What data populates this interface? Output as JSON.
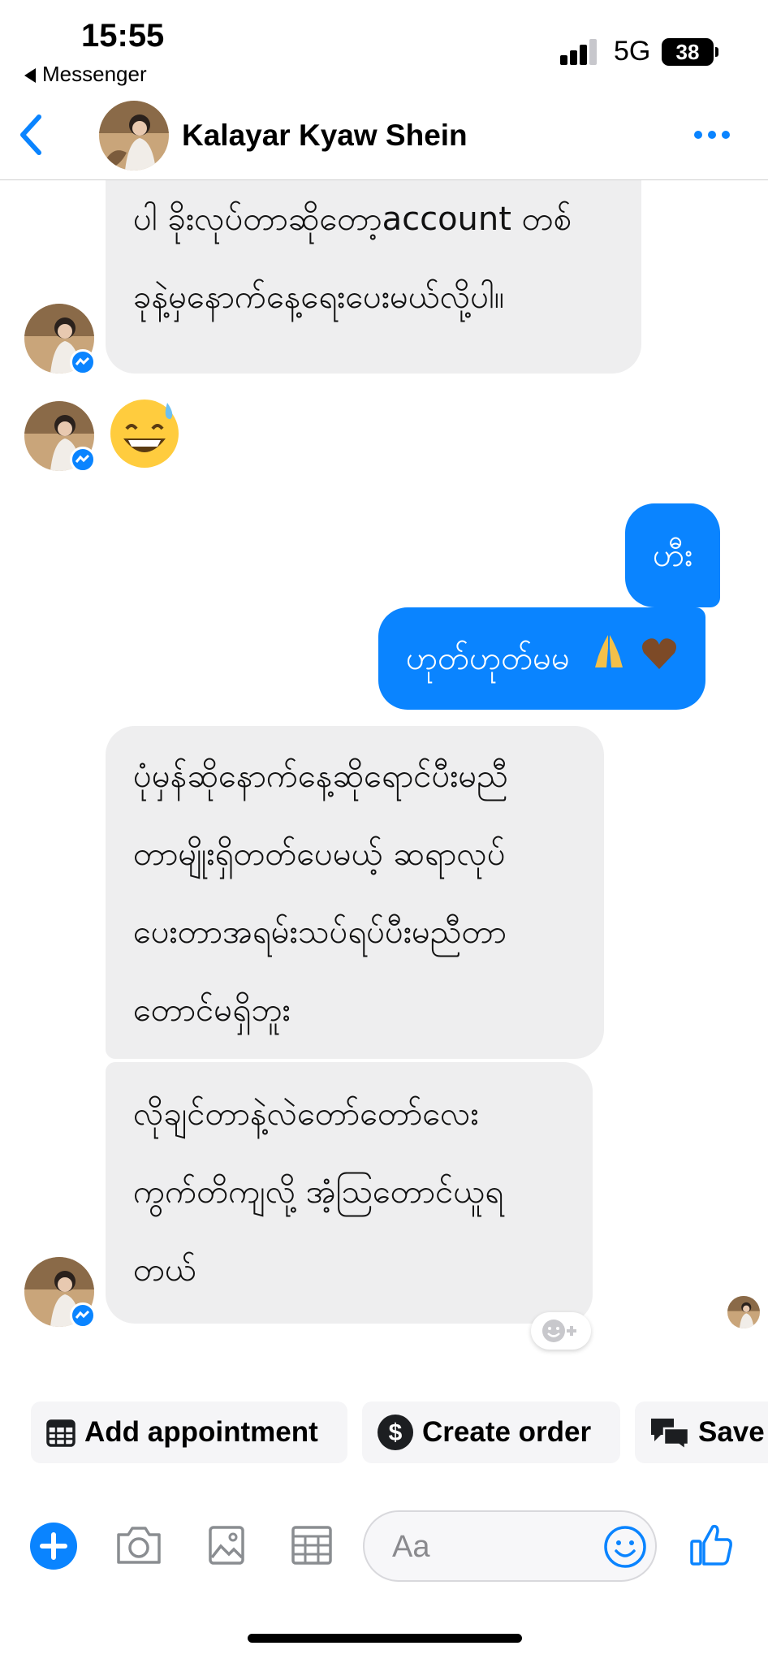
{
  "status_bar": {
    "time": "15:55",
    "back_app": "Messenger",
    "network": "5G",
    "battery": "38"
  },
  "header": {
    "contact_name": "Kalayar Kyaw Shein",
    "back_icon": "chevron-left-icon",
    "more_icon": "more-dots-icon"
  },
  "messages": {
    "in_1": {
      "line_1": "ပါ ခိုးလုပ်တာဆိုတော့account တစ်",
      "line_2": "ခုနဲ့မှနောက်နေ့ရေးပေးမယ်လို့ပါ။"
    },
    "in_2_emoji": "grinning-sweat-emoji",
    "out_1": "ဟီး",
    "out_2": {
      "text": "ဟုတ်ဟုတ်မမ",
      "emojis": [
        "praying-hands-emoji",
        "brown-heart-emoji"
      ]
    },
    "in_3": {
      "line_1": "ပုံမှန်ဆိုနောက်နေ့ဆိုရောင်ပီးမညီ",
      "line_2": "တာမျိုးရှိတတ်ပေမယ့် ဆရာလုပ်",
      "line_3": "ပေးတာအရမ်းသပ်ရပ်ပီးမညီတာ",
      "line_4": "တောင်မရှိဘူး"
    },
    "in_4": {
      "line_1": "လိုချင်တာနဲ့လဲတော်တော်လေး",
      "line_2": "ကွက်တိကျလို့ အံ့ဩတောင်ယူရ",
      "line_3": "တယ်"
    }
  },
  "quick_actions": {
    "add_appointment": "Add appointment",
    "create_order": "Create order",
    "save": "Save"
  },
  "composer": {
    "placeholder": "Aa"
  },
  "colors": {
    "accent": "#0a84ff",
    "incoming_bubble": "#eeeeef",
    "outgoing_bubble": "#0a84ff"
  }
}
